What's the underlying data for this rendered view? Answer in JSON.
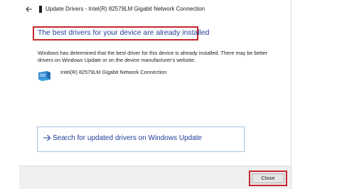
{
  "window": {
    "title": "Update Drivers - Intel(R) 82579LM Gigabit Network Connection"
  },
  "main": {
    "heading": "The best drivers for your device are already installed",
    "description": "Windows has determined that the best driver for this device is already installed. There may be better drivers on Windows Update or on the device manufacturer's website.",
    "device_name": "Intel(R) 82579LM Gigabit Network Connection",
    "search_link_label": "Search for updated drivers on Windows Update"
  },
  "footer": {
    "close_label": "Close"
  },
  "icons": {
    "back": "back-arrow-icon",
    "window": "window-icon",
    "device": "network-adapter-icon",
    "link_arrow": "arrow-right-icon"
  },
  "colors": {
    "highlight_border": "#c4262e",
    "link_blue": "#1f3d99",
    "link_border": "#a8c4e0",
    "footer_bg": "#f0f0f0"
  }
}
